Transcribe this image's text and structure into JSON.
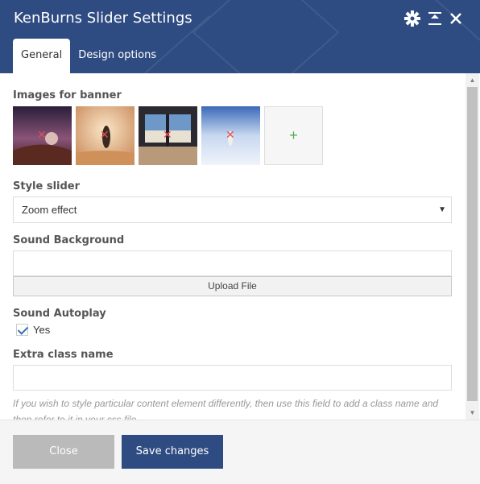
{
  "window": {
    "title": "KenBurns Slider Settings"
  },
  "tabs": [
    {
      "label": "General"
    },
    {
      "label": "Design options"
    }
  ],
  "icons": {
    "settings": "gear-icon",
    "minimize": "minimize-icon",
    "close": "close-icon",
    "add": "plus-icon",
    "remove": "remove-x-icon",
    "dropdown": "caret-down-icon"
  },
  "fields": {
    "images": {
      "label": "Images for banner",
      "thumbnails": [
        {
          "remove_glyph": "✕"
        },
        {
          "remove_glyph": "✕"
        },
        {
          "remove_glyph": "✕"
        },
        {
          "remove_glyph": "✕"
        }
      ],
      "add_glyph": "+"
    },
    "style_slider": {
      "label": "Style slider",
      "value": "Zoom effect"
    },
    "sound_background": {
      "label": "Sound Background",
      "value": "",
      "upload_label": "Upload File"
    },
    "sound_autoplay": {
      "label": "Sound Autoplay",
      "checkbox_label": "Yes",
      "checked": true
    },
    "extra_class": {
      "label": "Extra class name",
      "value": "",
      "help": "If you wish to style particular content element differently, then use this field to add a class name and then refer to it in your css file."
    }
  },
  "footer": {
    "close_label": "Close",
    "save_label": "Save changes"
  },
  "colors": {
    "header": "#2f4c82",
    "save_button": "#2f4c82",
    "close_button": "#bababa",
    "add_plus": "#4caf50",
    "remove_x": "#e05050"
  }
}
